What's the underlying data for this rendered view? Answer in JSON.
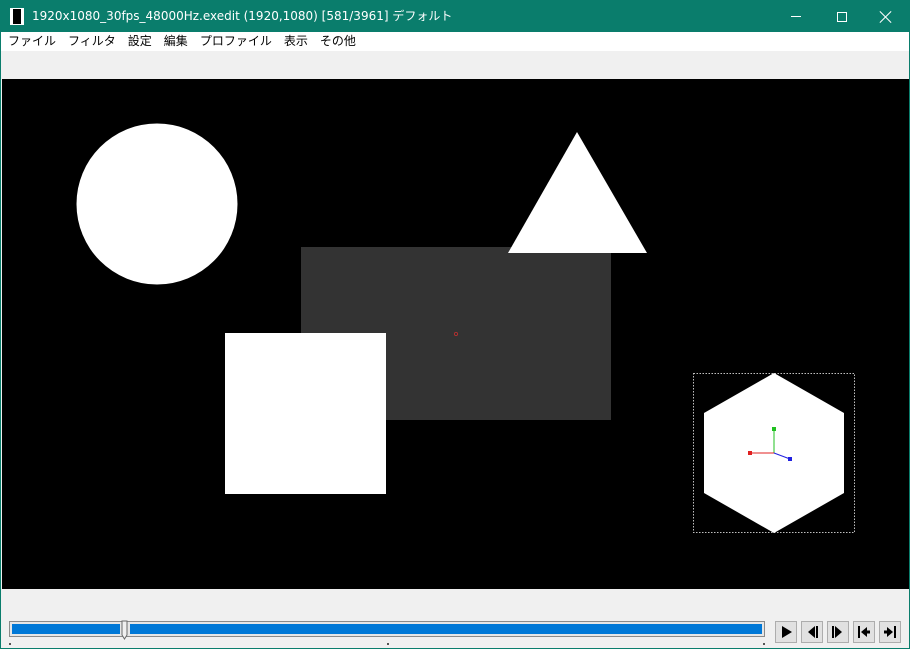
{
  "window": {
    "title": "1920x1080_30fps_48000Hz.exedit (1920,1080)  [581/3961]  デフォルト"
  },
  "menu": {
    "items": [
      "ファイル",
      "フィルタ",
      "設定",
      "編集",
      "プロファイル",
      "表示",
      "その他"
    ]
  },
  "canvas": {
    "background": "#000000",
    "shapes": [
      "circle",
      "triangle",
      "rectangle-gray",
      "square",
      "hexagon-selected"
    ],
    "colors": {
      "shape_fill": "#ffffff",
      "gray_rect": "#333333",
      "axis_x": "#e02020",
      "axis_y": "#20c020",
      "axis_z": "#2020e0"
    }
  },
  "timeline": {
    "current_frame": 581,
    "total_frames": 3961,
    "accent": "#0078d7"
  },
  "controls": {
    "buttons": [
      "play-icon",
      "prev-frame-icon",
      "next-frame-icon",
      "first-frame-icon",
      "last-frame-icon"
    ]
  }
}
